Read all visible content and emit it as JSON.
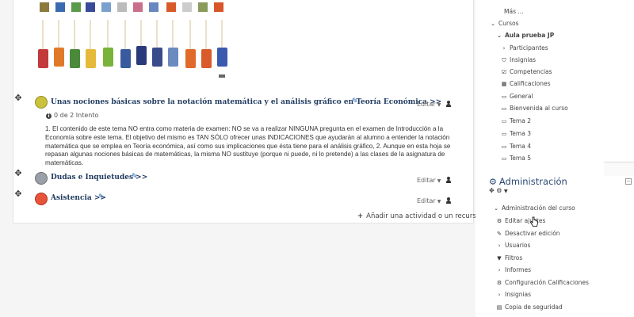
{
  "topics": [
    {
      "title": "Unas nociones básicas sobre la notación matemática y el análisis gráfico en Teoría Económica >>",
      "editar": "Editar",
      "attempts": "0 de 2 Intento",
      "description": "1. El contenido de este tema NO entra como materia de examen: NO se va a realizar NINGUNA pregunta en el examen de Introducción a la Economía sobre este tema. El objetivo del mismo es TAN SÓLO ofrecer unas INDICACIONES que ayudarán al alumno a entender la notación matemática que se emplea en Teoría económica, así como sus implicaciones que ésta tiene para el análisis gráfico, 2. Aunque en esta hoja se repasan algunas nociones básicas de matemáticas, la misma NO sustituye (porque ni puede, ni lo pretende) a las clases de la asignatura de matemáticas."
    },
    {
      "title": "Dudas e Inquietudes >>",
      "editar": "Editar"
    },
    {
      "title": "Asistencia >>",
      "editar": "Editar"
    }
  ],
  "add_activity": "Añadir una actividad o un recurso",
  "navigation": {
    "more": "Más ...",
    "cursos": "Cursos",
    "course_name": "Aula prueba JP",
    "items": [
      {
        "label": "Participantes",
        "icon": "chevron-right-icon"
      },
      {
        "label": "Insignias",
        "icon": "shield-icon"
      },
      {
        "label": "Competencias",
        "icon": "check-square-icon"
      },
      {
        "label": "Calificaciones",
        "icon": "table-icon"
      },
      {
        "label": "General",
        "icon": "folder-icon"
      },
      {
        "label": "Bienvenida al curso",
        "icon": "folder-icon"
      },
      {
        "label": "Tema 2",
        "icon": "folder-icon"
      },
      {
        "label": "Tema 3",
        "icon": "folder-icon"
      },
      {
        "label": "Tema 4",
        "icon": "folder-icon"
      },
      {
        "label": "Tema 5",
        "icon": "folder-icon"
      }
    ]
  },
  "admin": {
    "title": "Administración",
    "section": "Administración del curso",
    "items": [
      {
        "label": "Editar ajustes",
        "icon": "gear-icon"
      },
      {
        "label": "Desactivar edición",
        "icon": "pencil-icon"
      },
      {
        "label": "Usuarios",
        "icon": "chevron-right-icon"
      },
      {
        "label": "Filtros",
        "icon": "filter-icon"
      },
      {
        "label": "Informes",
        "icon": "chevron-right-icon"
      },
      {
        "label": "Configuración Calificaciones",
        "icon": "gear-icon"
      },
      {
        "label": "Insignias",
        "icon": "chevron-right-icon"
      },
      {
        "label": "Copia de seguridad",
        "icon": "file-icon"
      }
    ]
  },
  "colors": {
    "link": "#1f3a5f",
    "accent": "#1a63b8",
    "admin_title": "#2b4a73"
  }
}
